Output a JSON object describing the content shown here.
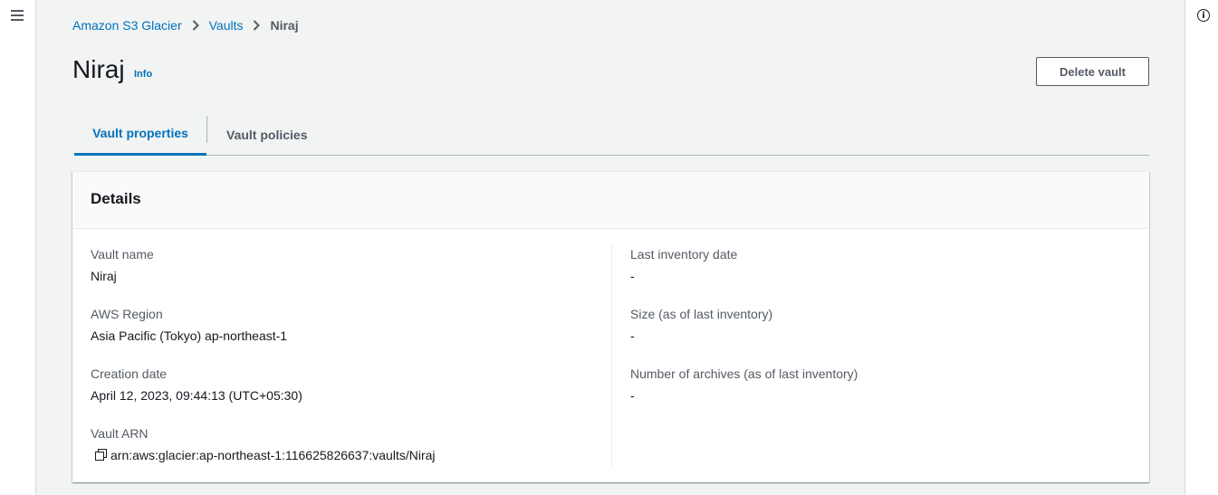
{
  "breadcrumb": {
    "items": [
      "Amazon S3 Glacier",
      "Vaults"
    ],
    "current": "Niraj"
  },
  "page": {
    "title": "Niraj",
    "info_label": "Info",
    "delete_label": "Delete vault"
  },
  "tabs": [
    {
      "label": "Vault properties",
      "active": true
    },
    {
      "label": "Vault policies",
      "active": false
    }
  ],
  "details": {
    "title": "Details",
    "left": [
      {
        "label": "Vault name",
        "value": "Niraj"
      },
      {
        "label": "AWS Region",
        "value": "Asia Pacific (Tokyo) ap-northeast-1"
      },
      {
        "label": "Creation date",
        "value": "April 12, 2023, 09:44:13 (UTC+05:30)"
      },
      {
        "label": "Vault ARN",
        "value": "arn:aws:glacier:ap-northeast-1:116625826637:vaults/Niraj"
      }
    ],
    "right": [
      {
        "label": "Last inventory date",
        "value": "-"
      },
      {
        "label": "Size (as of last inventory)",
        "value": "-"
      },
      {
        "label": "Number of archives (as of last inventory)",
        "value": "-"
      }
    ]
  },
  "colors": {
    "link": "#0073bb",
    "text": "#16191f",
    "muted": "#545b64",
    "background": "#f2f3f3"
  },
  "icons": [
    "menu-icon",
    "info-icon",
    "chevron-right-icon",
    "copy-icon"
  ]
}
